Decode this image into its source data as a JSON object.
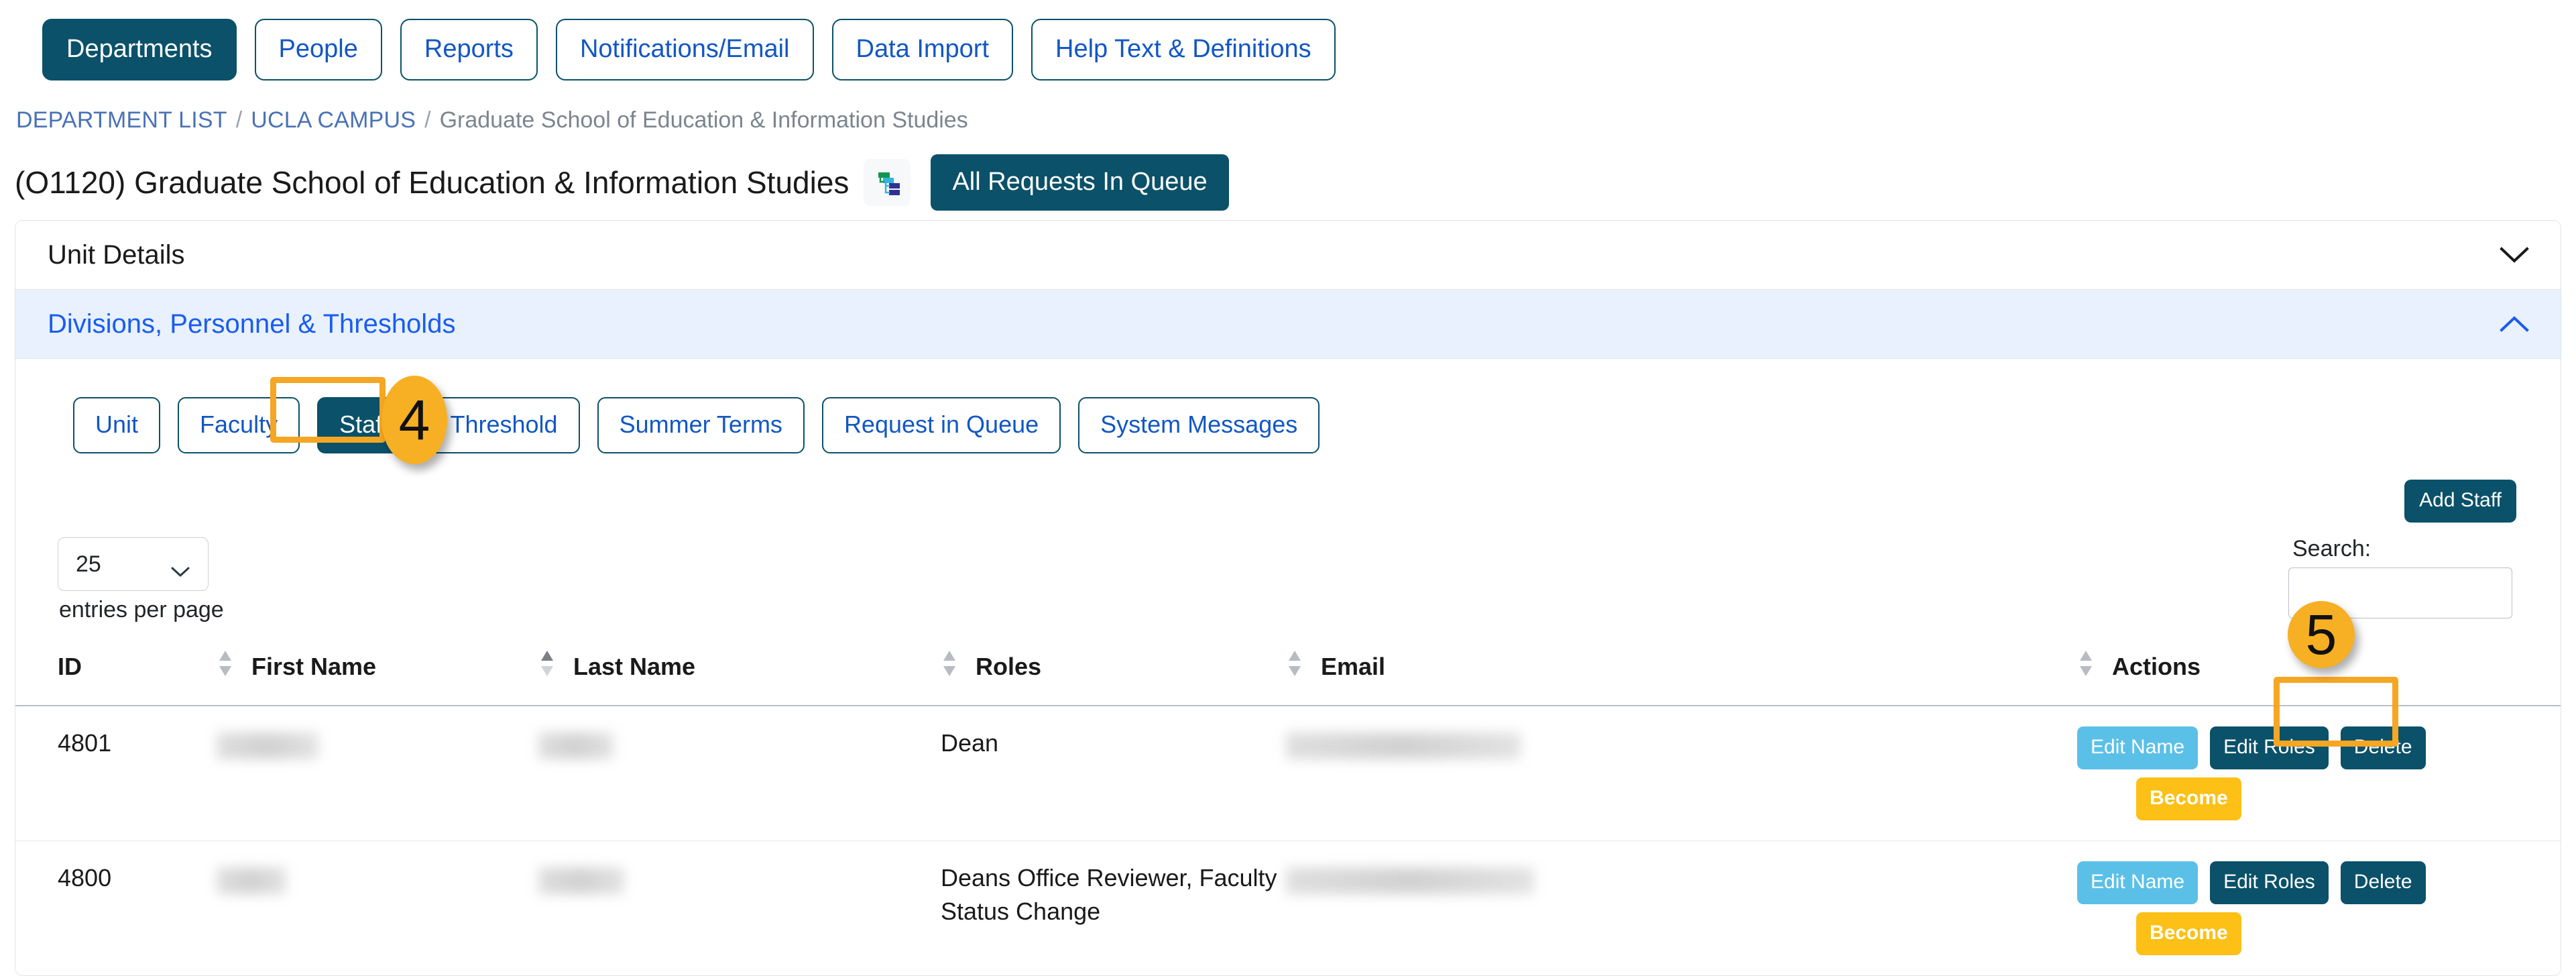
{
  "topnav": {
    "items": [
      {
        "label": "Departments",
        "active": true
      },
      {
        "label": "People",
        "active": false
      },
      {
        "label": "Reports",
        "active": false
      },
      {
        "label": "Notifications/Email",
        "active": false
      },
      {
        "label": "Data Import",
        "active": false
      },
      {
        "label": "Help Text & Definitions",
        "active": false
      }
    ]
  },
  "breadcrumb": {
    "root": "DEPARTMENT LIST",
    "sep1": "/",
    "campus": "UCLA CAMPUS",
    "sep2": "/",
    "current": "Graduate School of Education & Information Studies"
  },
  "header": {
    "title": "(O1120) Graduate School of Education & Information Studies",
    "hierarchy_icon": "hierarchy-icon",
    "queue_button": "All Requests In Queue"
  },
  "accordions": [
    {
      "title": "Unit Details",
      "expanded": false,
      "chevron": "chevron-down-icon"
    },
    {
      "title": "Divisions, Personnel & Thresholds",
      "expanded": true,
      "chevron": "chevron-up-icon"
    }
  ],
  "subtabs": [
    {
      "label": "Unit",
      "active": false
    },
    {
      "label": "Faculty",
      "active": false
    },
    {
      "label": "Staff",
      "active": true
    },
    {
      "label": "Threshold",
      "active": false
    },
    {
      "label": "Summer Terms",
      "active": false
    },
    {
      "label": "Request in Queue",
      "active": false
    },
    {
      "label": "System Messages",
      "active": false
    }
  ],
  "toolbar": {
    "add_staff_label": "Add Staff",
    "per_page_value": "25",
    "per_page_label": "entries per page",
    "search_label": "Search:",
    "search_value": "",
    "search_placeholder": ""
  },
  "table": {
    "columns": [
      {
        "label": "ID",
        "sort": "none"
      },
      {
        "label": "First Name",
        "sort": "asc"
      },
      {
        "label": "Last Name",
        "sort": "none"
      },
      {
        "label": "Roles",
        "sort": "none"
      },
      {
        "label": "Email",
        "sort": "none"
      },
      {
        "label": "Actions",
        "sort": "none"
      }
    ],
    "rows": [
      {
        "id": "4801",
        "first_name": "",
        "last_name": "",
        "roles": "Dean",
        "email": "",
        "actions": {
          "edit_name": "Edit Name",
          "edit_roles": "Edit Roles",
          "delete": "Delete",
          "become": "Become"
        }
      },
      {
        "id": "4800",
        "first_name": "",
        "last_name": "",
        "roles": "Deans Office Reviewer, Faculty Status Change",
        "email": "",
        "actions": {
          "edit_name": "Edit Name",
          "edit_roles": "Edit Roles",
          "delete": "Delete",
          "become": "Become"
        }
      }
    ]
  },
  "annotations": [
    {
      "label": "4",
      "target": "staff-subtab"
    },
    {
      "label": "5",
      "target": "edit-roles-button"
    }
  ],
  "colors": {
    "primary_dark": "#0a5169",
    "link_blue": "#1257c4",
    "accent_orange": "#f7b024",
    "become_yellow": "#fcc016",
    "light_blue_button": "#5bc0e8",
    "expanded_header_bg": "#e8f1fd"
  }
}
